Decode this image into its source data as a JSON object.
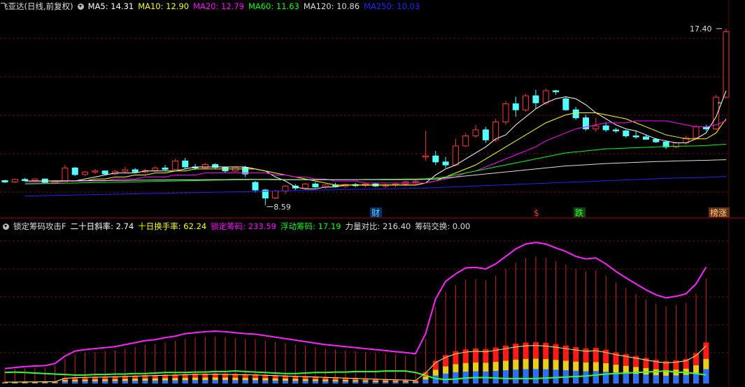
{
  "header_top": {
    "title": "飞亚达(日线,前复权)",
    "ma": [
      {
        "label": "MA5: 14.31",
        "color": "#ffffff"
      },
      {
        "label": "MA10: 12.90",
        "color": "#ffff00"
      },
      {
        "label": "MA20: 12.79",
        "color": "#ff00ff"
      },
      {
        "label": "MA60: 11.63",
        "color": "#00ff00"
      },
      {
        "label": "MA120: 10.86",
        "color": "#dddddd"
      },
      {
        "label": "MA250: 10.03",
        "color": "#2222ff"
      }
    ]
  },
  "header_bottom": {
    "title": "锁定筹码攻击F",
    "items": [
      {
        "label": "二十日斜率: 2.74",
        "color": "#ffffff"
      },
      {
        "label": "十日换手率: 62.24",
        "color": "#ffff00"
      },
      {
        "label": "锁定筹码: 233.59",
        "color": "#ff00ff"
      },
      {
        "label": "浮动筹码: 17.19",
        "color": "#00ff00"
      },
      {
        "label": "力量对比: 216.40",
        "color": "#dddddd"
      },
      {
        "label": "筹码交换: 0.00",
        "color": "#dddddd"
      }
    ]
  },
  "annotations": {
    "high_label": "17.40",
    "low_label": "8.59",
    "markers": [
      {
        "text": "财",
        "color": "#66ccff",
        "bg": "#003366"
      },
      {
        "text": "$",
        "color": "#ff3333",
        "bg": ""
      },
      {
        "text": "跌",
        "color": "#33ff33",
        "bg": "#114411"
      },
      {
        "text": "榜涨",
        "color": "#ffcc88",
        "bg": "#663311"
      }
    ]
  },
  "chart_data": [
    {
      "type": "candlestick",
      "x_count": 69,
      "ohlc": [
        [
          9.82,
          9.86,
          9.7,
          9.75
        ],
        [
          9.75,
          9.92,
          9.7,
          9.88
        ],
        [
          9.88,
          9.95,
          9.78,
          9.82
        ],
        [
          9.82,
          9.95,
          9.75,
          9.9
        ],
        [
          9.9,
          9.92,
          9.7,
          9.73
        ],
        [
          9.73,
          9.8,
          9.66,
          9.76
        ],
        [
          9.76,
          10.6,
          9.75,
          10.45
        ],
        [
          10.45,
          10.5,
          10.05,
          10.12
        ],
        [
          10.12,
          10.3,
          10.05,
          10.25
        ],
        [
          10.25,
          10.4,
          10.15,
          10.3
        ],
        [
          10.3,
          10.33,
          10.1,
          10.15
        ],
        [
          10.15,
          10.35,
          10.1,
          10.28
        ],
        [
          10.28,
          10.5,
          10.2,
          10.36
        ],
        [
          10.36,
          10.45,
          10.2,
          10.25
        ],
        [
          10.25,
          10.4,
          10.18,
          10.32
        ],
        [
          10.32,
          10.55,
          10.25,
          10.45
        ],
        [
          10.45,
          10.6,
          10.3,
          10.38
        ],
        [
          10.38,
          10.9,
          10.35,
          10.8
        ],
        [
          10.8,
          10.95,
          10.4,
          10.5
        ],
        [
          10.5,
          10.65,
          10.35,
          10.45
        ],
        [
          10.45,
          10.7,
          10.4,
          10.62
        ],
        [
          10.62,
          10.68,
          10.4,
          10.48
        ],
        [
          10.48,
          10.52,
          10.2,
          10.3
        ],
        [
          10.3,
          10.55,
          10.25,
          10.48
        ],
        [
          10.48,
          10.55,
          10.0,
          10.15
        ],
        [
          9.73,
          9.8,
          9.22,
          9.35
        ],
        [
          9.35,
          9.4,
          8.59,
          8.95
        ],
        [
          8.95,
          9.35,
          8.9,
          9.3
        ],
        [
          9.3,
          9.6,
          9.15,
          9.55
        ],
        [
          9.55,
          9.65,
          9.35,
          9.45
        ],
        [
          9.45,
          9.7,
          9.4,
          9.65
        ],
        [
          9.65,
          9.75,
          9.45,
          9.5
        ],
        [
          9.5,
          9.65,
          9.4,
          9.6
        ],
        [
          9.6,
          9.7,
          9.48,
          9.55
        ],
        [
          9.55,
          9.68,
          9.45,
          9.62
        ],
        [
          9.62,
          9.7,
          9.5,
          9.58
        ],
        [
          9.58,
          9.7,
          9.5,
          9.65
        ],
        [
          9.65,
          9.72,
          9.5,
          9.55
        ],
        [
          9.55,
          9.68,
          9.45,
          9.6
        ],
        [
          9.6,
          9.68,
          9.5,
          9.65
        ],
        [
          9.65,
          9.8,
          9.55,
          9.75
        ],
        [
          9.75,
          9.85,
          9.65,
          9.78
        ],
        [
          11.0,
          12.3,
          10.8,
          11.05
        ],
        [
          11.05,
          11.3,
          10.6,
          10.75
        ],
        [
          10.75,
          11.0,
          10.45,
          10.6
        ],
        [
          10.6,
          11.9,
          10.55,
          11.55
        ],
        [
          11.55,
          12.2,
          11.5,
          12.05
        ],
        [
          12.05,
          12.6,
          11.95,
          12.35
        ],
        [
          12.35,
          12.5,
          11.7,
          11.85
        ],
        [
          11.85,
          12.9,
          11.75,
          12.75
        ],
        [
          12.75,
          13.8,
          12.6,
          13.65
        ],
        [
          13.65,
          14.0,
          13.0,
          13.35
        ],
        [
          13.35,
          14.15,
          13.25,
          14.05
        ],
        [
          14.05,
          14.35,
          13.4,
          13.7
        ],
        [
          13.7,
          14.4,
          13.6,
          14.3
        ],
        [
          14.3,
          14.35,
          14.1,
          14.25
        ],
        [
          13.9,
          14.0,
          13.3,
          13.35
        ],
        [
          13.35,
          13.5,
          12.85,
          12.95
        ],
        [
          12.95,
          13.1,
          12.3,
          12.4
        ],
        [
          12.4,
          12.95,
          12.25,
          12.55
        ],
        [
          12.55,
          12.7,
          12.25,
          12.35
        ],
        [
          12.35,
          12.45,
          12.2,
          12.3
        ],
        [
          12.3,
          12.35,
          11.95,
          12.05
        ],
        [
          12.05,
          12.3,
          11.9,
          12.0
        ],
        [
          12.0,
          12.1,
          11.85,
          11.88
        ],
        [
          11.88,
          11.95,
          11.7,
          11.75
        ],
        [
          11.75,
          11.8,
          11.4,
          11.5
        ],
        [
          11.5,
          11.75,
          11.45,
          11.7
        ],
        [
          11.7,
          12.05,
          11.6,
          11.95
        ],
        [
          11.95,
          12.6,
          11.9,
          12.5
        ],
        [
          12.5,
          12.6,
          12.3,
          12.4
        ],
        [
          12.4,
          14.1,
          12.35,
          13.98
        ],
        [
          13.98,
          17.4,
          13.9,
          17.25
        ]
      ],
      "ma": {
        "ma5": [
          9.8,
          9.8,
          9.8,
          9.8,
          9.8,
          9.8,
          9.9,
          10.0,
          10.1,
          10.2,
          10.2,
          10.2,
          10.3,
          10.3,
          10.3,
          10.3,
          10.4,
          10.5,
          10.5,
          10.5,
          10.5,
          10.5,
          10.5,
          10.4,
          10.3,
          10.0,
          9.8,
          9.5,
          9.4,
          9.4,
          9.5,
          9.5,
          9.6,
          9.6,
          9.6,
          9.6,
          9.6,
          9.6,
          9.6,
          9.6,
          9.7,
          10.1,
          10.4,
          10.6,
          10.9,
          11.2,
          11.5,
          11.9,
          12.1,
          12.6,
          13.0,
          13.4,
          13.7,
          13.9,
          14.0,
          13.9,
          13.6,
          13.2,
          12.9,
          12.6,
          12.4,
          12.3,
          12.1,
          11.9,
          11.8,
          11.7,
          11.7,
          11.9,
          12.2,
          13.0,
          14.3
        ],
        "ma10": [
          9.8,
          9.8,
          9.8,
          9.8,
          9.8,
          9.8,
          9.8,
          9.9,
          9.9,
          10.0,
          10.0,
          10.1,
          10.1,
          10.2,
          10.2,
          10.3,
          10.3,
          10.4,
          10.4,
          10.4,
          10.4,
          10.4,
          10.4,
          10.4,
          10.3,
          10.2,
          10.1,
          10.0,
          9.9,
          9.8,
          9.7,
          9.6,
          9.6,
          9.6,
          9.6,
          9.6,
          9.6,
          9.6,
          9.6,
          9.6,
          9.7,
          9.8,
          10.0,
          10.2,
          10.4,
          10.6,
          10.9,
          11.2,
          11.5,
          11.8,
          12.1,
          12.4,
          12.7,
          12.9,
          13.1,
          13.2,
          13.2,
          13.2,
          13.1,
          13.0,
          12.9,
          12.7,
          12.5,
          12.3,
          12.1,
          12.0,
          11.9,
          11.9,
          11.9,
          12.2,
          12.9
        ],
        "ma20": [
          9.7,
          9.7,
          9.7,
          9.7,
          9.8,
          9.8,
          9.8,
          9.8,
          9.8,
          9.9,
          9.9,
          9.9,
          10.0,
          10.0,
          10.0,
          10.1,
          10.1,
          10.1,
          10.2,
          10.2,
          10.2,
          10.2,
          10.2,
          10.2,
          10.2,
          10.1,
          10.1,
          10.0,
          10.0,
          9.9,
          9.9,
          9.8,
          9.8,
          9.8,
          9.7,
          9.7,
          9.7,
          9.7,
          9.7,
          9.7,
          9.7,
          9.8,
          9.9,
          10.0,
          10.2,
          10.3,
          10.5,
          10.7,
          10.9,
          11.1,
          11.3,
          11.5,
          11.8,
          12.0,
          12.2,
          12.4,
          12.5,
          12.6,
          12.7,
          12.7,
          12.7,
          12.8,
          12.8,
          12.8,
          12.8,
          12.7,
          12.6,
          12.5,
          12.5,
          12.6,
          12.8
        ],
        "ma60": [
          9.65,
          9.66,
          9.67,
          9.68,
          9.69,
          9.7,
          9.71,
          9.72,
          9.73,
          9.74,
          9.75,
          9.76,
          9.77,
          9.78,
          9.79,
          9.8,
          9.81,
          9.82,
          9.83,
          9.84,
          9.85,
          9.86,
          9.86,
          9.87,
          9.87,
          9.86,
          9.86,
          9.86,
          9.86,
          9.86,
          9.86,
          9.87,
          9.87,
          9.87,
          9.88,
          9.88,
          9.89,
          9.89,
          9.9,
          9.9,
          9.91,
          9.95,
          10.0,
          10.1,
          10.2,
          10.3,
          10.4,
          10.5,
          10.6,
          10.7,
          10.8,
          10.9,
          11.0,
          11.1,
          11.2,
          11.25,
          11.3,
          11.35,
          11.4,
          11.42,
          11.44,
          11.46,
          11.48,
          11.5,
          11.52,
          11.53,
          11.54,
          11.55,
          11.57,
          11.6,
          11.63
        ],
        "ma120": [
          9.8,
          9.8,
          9.8,
          9.81,
          9.81,
          9.81,
          9.82,
          9.82,
          9.82,
          9.83,
          9.83,
          9.84,
          9.84,
          9.85,
          9.85,
          9.86,
          9.86,
          9.86,
          9.87,
          9.87,
          9.87,
          9.88,
          9.88,
          9.88,
          9.88,
          9.88,
          9.87,
          9.87,
          9.87,
          9.87,
          9.87,
          9.87,
          9.87,
          9.87,
          9.87,
          9.87,
          9.87,
          9.87,
          9.87,
          9.87,
          9.88,
          9.9,
          9.95,
          10.0,
          10.05,
          10.1,
          10.15,
          10.2,
          10.25,
          10.3,
          10.35,
          10.4,
          10.45,
          10.5,
          10.55,
          10.58,
          10.61,
          10.64,
          10.67,
          10.69,
          10.71,
          10.73,
          10.75,
          10.77,
          10.78,
          10.8,
          10.81,
          10.82,
          10.83,
          10.85,
          10.86
        ],
        "ma250": [
          9.05,
          9.06,
          9.07,
          9.08,
          9.09,
          9.1,
          9.11,
          9.12,
          9.13,
          9.14,
          9.15,
          9.16,
          9.17,
          9.18,
          9.19,
          9.2,
          9.21,
          9.22,
          9.23,
          9.24,
          9.25,
          9.26,
          9.27,
          9.28,
          9.29,
          9.3,
          9.31,
          9.32,
          9.33,
          9.34,
          9.35,
          9.36,
          9.37,
          9.38,
          9.39,
          9.4,
          9.41,
          9.42,
          9.43,
          9.44,
          9.45,
          9.47,
          9.49,
          9.51,
          9.53,
          9.55,
          9.57,
          9.59,
          9.61,
          9.63,
          9.65,
          9.67,
          9.69,
          9.71,
          9.73,
          9.75,
          9.77,
          9.79,
          9.81,
          9.83,
          9.85,
          9.87,
          9.89,
          9.91,
          9.93,
          9.95,
          9.96,
          9.97,
          9.98,
          10.0,
          10.03
        ]
      },
      "ylim": [
        8.2,
        18.2
      ]
    },
    {
      "type": "bar",
      "series": [
        {
          "name": "锁定筹码",
          "values": [
            30,
            32,
            34,
            35,
            36,
            40,
            55,
            65,
            68,
            70,
            72,
            74,
            78,
            82,
            86,
            88,
            92,
            95,
            100,
            102,
            104,
            105,
            104,
            102,
            100,
            99,
            96,
            93,
            90,
            87,
            84,
            81,
            78,
            76,
            74,
            72,
            70,
            68,
            66,
            64,
            62,
            60,
            100,
            170,
            205,
            220,
            232,
            233,
            230,
            240,
            255,
            270,
            280,
            283,
            280,
            272,
            265,
            255,
            250,
            252,
            240,
            225,
            212,
            200,
            188,
            178,
            172,
            175,
            180,
            200,
            233.59
          ]
        },
        {
          "name": "浮动筹码",
          "values": [
            22,
            23,
            22,
            21,
            20,
            19,
            18,
            17,
            17,
            18,
            18,
            19,
            19,
            20,
            20,
            21,
            22,
            22,
            22,
            23,
            23,
            24,
            24,
            25,
            24,
            23,
            22,
            21,
            20,
            20,
            21,
            22,
            22,
            23,
            23,
            24,
            24,
            24,
            25,
            25,
            25,
            22,
            16,
            10,
            8,
            9,
            11,
            12,
            12,
            11,
            10,
            10,
            10,
            10,
            11,
            12,
            13,
            14,
            15,
            17,
            19,
            20,
            21,
            22,
            23,
            24,
            25,
            23,
            22,
            20,
            17.19
          ]
        },
        {
          "name": "力量对比",
          "values": [
            8,
            8,
            9,
            9,
            10,
            10,
            30,
            33,
            35,
            36,
            37,
            38,
            40,
            42,
            44,
            45,
            47,
            48,
            50,
            52,
            52,
            53,
            52,
            51,
            50,
            49,
            47,
            45,
            43,
            41,
            39,
            37,
            35,
            33,
            31,
            29,
            27,
            25,
            23,
            21,
            20,
            18,
            60,
            120,
            150,
            170,
            180,
            185,
            182,
            190,
            200,
            210,
            216,
            218,
            215,
            208,
            200,
            192,
            185,
            188,
            178,
            165,
            155,
            145,
            135,
            125,
            118,
            122,
            130,
            160,
            216.4
          ]
        }
      ],
      "ylim": [
        0,
        300
      ]
    }
  ]
}
